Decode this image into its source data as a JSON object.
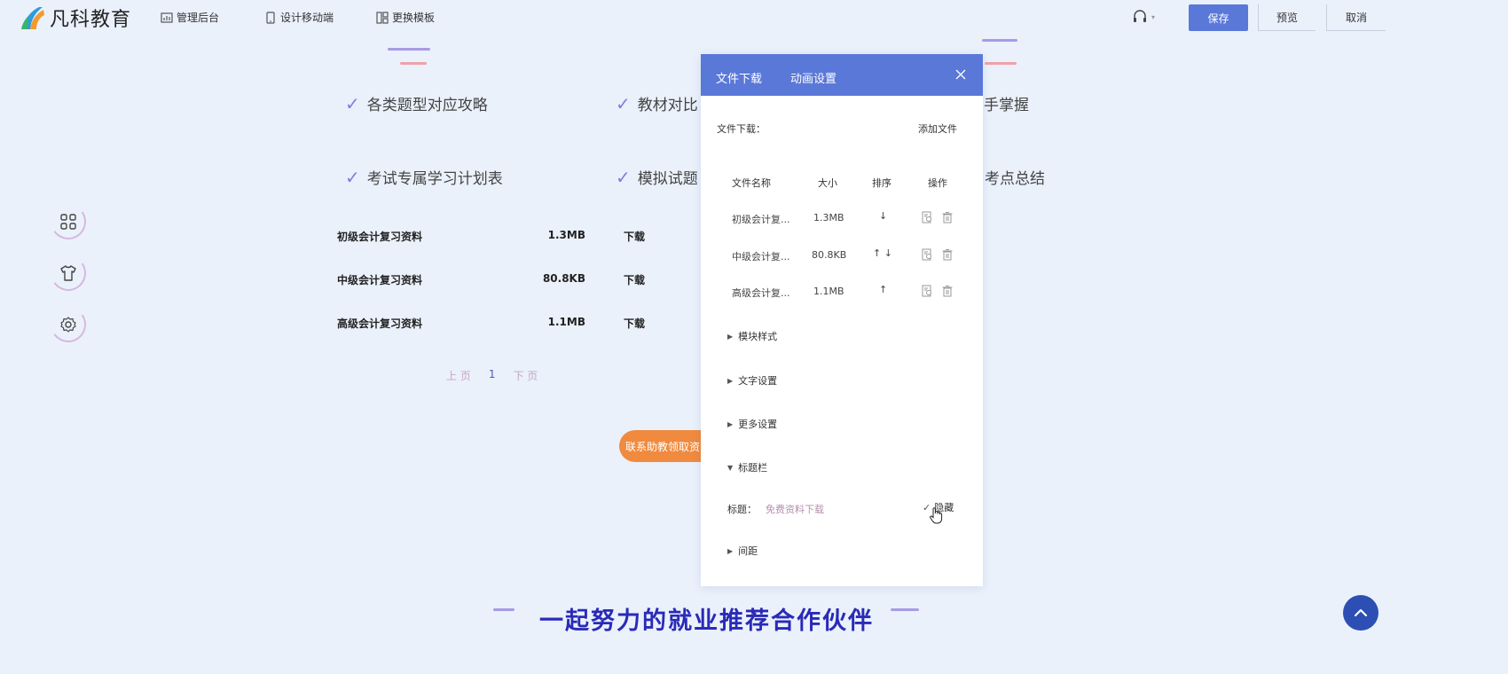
{
  "brand": {
    "name": "凡科教育"
  },
  "topbar": {
    "nav": [
      {
        "label": "管理后台",
        "icon": "bar-chart-icon"
      },
      {
        "label": "设计移动端",
        "icon": "mobile-icon"
      },
      {
        "label": "更换模板",
        "icon": "template-icon"
      }
    ],
    "save_label": "保存",
    "preview_label": "预览",
    "cancel_label": "取消"
  },
  "features": [
    "各类题型对应攻略",
    "教材对比",
    "手掌握",
    "考试专属学习计划表",
    "模拟试题",
    "考点总结"
  ],
  "files": [
    {
      "name": "初级会计复习资料",
      "size": "1.3MB",
      "action": "下载"
    },
    {
      "name": "中级会计复习资料",
      "size": "80.8KB",
      "action": "下载"
    },
    {
      "name": "高级会计复习资料",
      "size": "1.1MB",
      "action": "下载"
    }
  ],
  "pager": {
    "prev": "上 页",
    "current": "1",
    "next": "下 页"
  },
  "contact_button": "联系助教领取资",
  "bottom_title": "一起努力的就业推荐合作伙伴",
  "panel": {
    "tabs": [
      "文件下载",
      "动画设置"
    ],
    "file_download_label": "文件下载：",
    "add_file": "添加文件",
    "columns": [
      "文件名称",
      "大小",
      "排序",
      "操作"
    ],
    "rows": [
      {
        "name": "初级会计复...",
        "size": "1.3MB",
        "sort": "↓"
      },
      {
        "name": "中级会计复...",
        "size": "80.8KB",
        "sort": "↑ ↓"
      },
      {
        "name": "高级会计复...",
        "size": "1.1MB",
        "sort": "↑"
      }
    ],
    "sections": [
      "模块样式",
      "文字设置",
      "更多设置",
      "标题栏"
    ],
    "title_label": "标题：",
    "title_value": "免费资料下载",
    "hide_label": "隐藏",
    "spacing_section": "间距"
  },
  "colors": {
    "accent": "#5a78d8",
    "orange": "#f08a3e",
    "title_blue": "#2a2ab8"
  }
}
